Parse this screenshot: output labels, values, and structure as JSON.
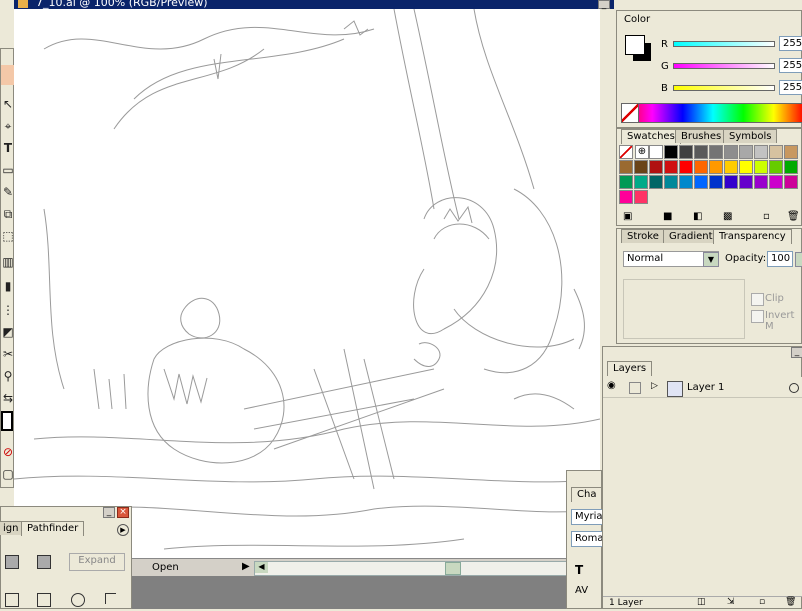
{
  "document": {
    "title": "7_10.ai @ 100% (RGB/Preview)",
    "status_mode": "Open"
  },
  "color_panel": {
    "tab": "Color",
    "channels": [
      {
        "label": "R",
        "value": "255"
      },
      {
        "label": "G",
        "value": "255"
      },
      {
        "label": "B",
        "value": "255"
      }
    ]
  },
  "swatch_panel": {
    "tabs": [
      "Swatches",
      "Brushes",
      "Symbols"
    ],
    "colors": [
      "#ffffff",
      "#000000",
      "#404040",
      "#5a5a5a",
      "#747474",
      "#8e8e8e",
      "#a8a8a8",
      "#c2c2c2",
      "#d6c2a0",
      "#c89860",
      "#9a6a30",
      "#6a4418",
      "#b01010",
      "#d01010",
      "#ff0000",
      "#ff6600",
      "#ff9900",
      "#ffcc00",
      "#ffff00",
      "#ccff00",
      "#66cc00",
      "#00aa00",
      "#009955",
      "#00aa88",
      "#006666",
      "#008899",
      "#0088cc",
      "#0066ff",
      "#0033cc",
      "#3300cc",
      "#6600cc",
      "#9900cc",
      "#cc00cc",
      "#cc0099",
      "#ff0099",
      "#ff3366"
    ]
  },
  "transparency_panel": {
    "tabs": [
      "Stroke",
      "Gradient",
      "Transparency"
    ],
    "blend_mode": "Normal",
    "opacity_label": "Opacity:",
    "opacity_value": "100",
    "clip_label": "Clip",
    "invert_label": "Invert M"
  },
  "layers_panel": {
    "tab": "Layers",
    "layers": [
      {
        "name": "Layer 1"
      }
    ],
    "footer": "1 Layer"
  },
  "pathfinder_panel": {
    "tabs": [
      "ign",
      "Pathfinder"
    ],
    "expand_label": "Expand"
  },
  "character_panel": {
    "tab": "Cha",
    "font_family": "Myria",
    "font_style": "Roma"
  }
}
